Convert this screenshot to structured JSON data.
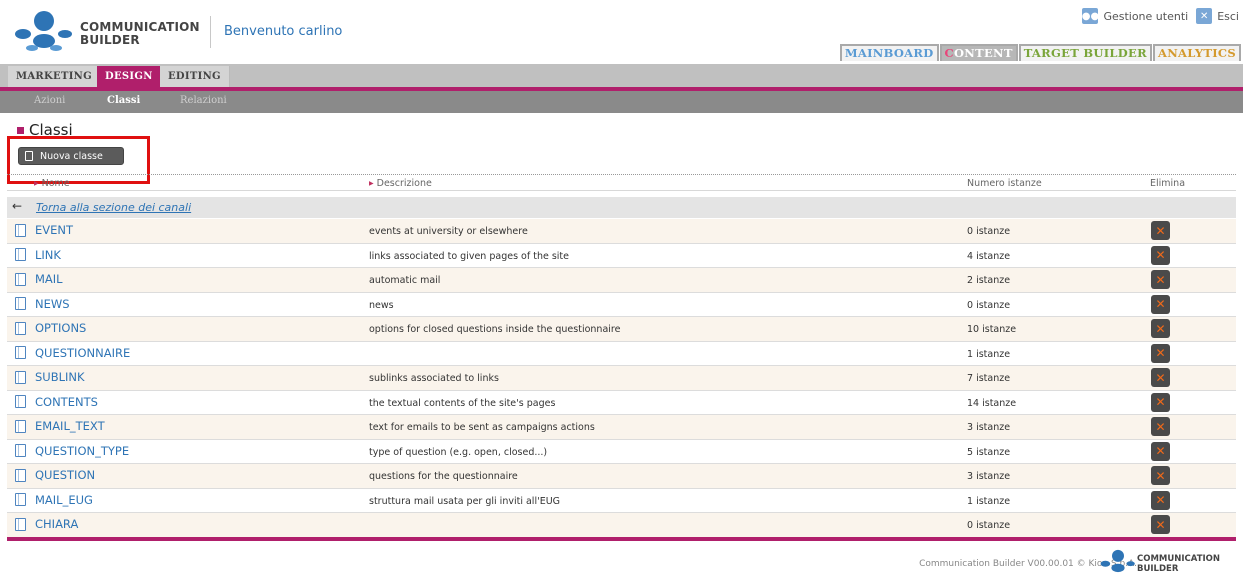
{
  "brand": {
    "logo_line1": "COMMUNICATION",
    "logo_line2": "BUILDER",
    "welcome": "Benvenuto carlino"
  },
  "top_links": {
    "users": "Gestione utenti",
    "exit": "Esci"
  },
  "main_tabs": [
    {
      "first": "M",
      "rest": "AINBOARD"
    },
    {
      "first": "C",
      "rest": "ONTENT"
    },
    {
      "first": "T",
      "rest": "ARGET BUILDER"
    },
    {
      "first": "A",
      "rest": "NALYTICS"
    }
  ],
  "sub_tabs": [
    "MARKETING",
    "DESIGN",
    "EDITING"
  ],
  "subsub_tabs": [
    "Azioni",
    "Classi",
    "Relazioni"
  ],
  "section_title": "Classi",
  "new_button": "Nuova classe",
  "columns": {
    "name": "Nome",
    "desc": "Descrizione",
    "num": "Numero istanze",
    "del": "Elimina"
  },
  "back_link": "Torna alla sezione dei canali",
  "rows": [
    {
      "name": "EVENT",
      "desc": "events at university or elsewhere",
      "num": "0 istanze"
    },
    {
      "name": "LINK",
      "desc": "links associated to given pages of the site",
      "num": "4 istanze"
    },
    {
      "name": "MAIL",
      "desc": "automatic mail",
      "num": "2 istanze"
    },
    {
      "name": "NEWS",
      "desc": "news",
      "num": "0 istanze"
    },
    {
      "name": "OPTIONS",
      "desc": "options for closed questions inside the questionnaire",
      "num": "10 istanze"
    },
    {
      "name": "QUESTIONNAIRE",
      "desc": "",
      "num": "1 istanze"
    },
    {
      "name": "SUBLINK",
      "desc": "sublinks associated to links",
      "num": "7 istanze"
    },
    {
      "name": "CONTENTS",
      "desc": "the textual contents of the site's pages",
      "num": "14 istanze"
    },
    {
      "name": "EMAIL_TEXT",
      "desc": "text for emails to be sent as campaigns actions",
      "num": "3 istanze"
    },
    {
      "name": "QUESTION_TYPE",
      "desc": "type of question (e.g. open, closed...)",
      "num": "5 istanze"
    },
    {
      "name": "QUESTION",
      "desc": "questions for the questionnaire",
      "num": "3 istanze"
    },
    {
      "name": "MAIL_EUG",
      "desc": "struttura mail usata per gli inviti all'EUG",
      "num": "1 istanze"
    },
    {
      "name": "CHIARA",
      "desc": "",
      "num": "0 istanze"
    }
  ],
  "footer": {
    "text": "Communication Builder V00.00.01 © Kion S.p.A.",
    "logo_line1": "COMMUNICATION",
    "logo_line2": "BUILDER"
  },
  "icons": {
    "users": "users-icon",
    "exit": "close-icon",
    "file": "document-icon",
    "delete": "delete-icon",
    "back": "arrow-left-icon"
  },
  "colors": {
    "accent": "#b01f6b",
    "link": "#2e74b5",
    "delete": "#f06a1a"
  }
}
